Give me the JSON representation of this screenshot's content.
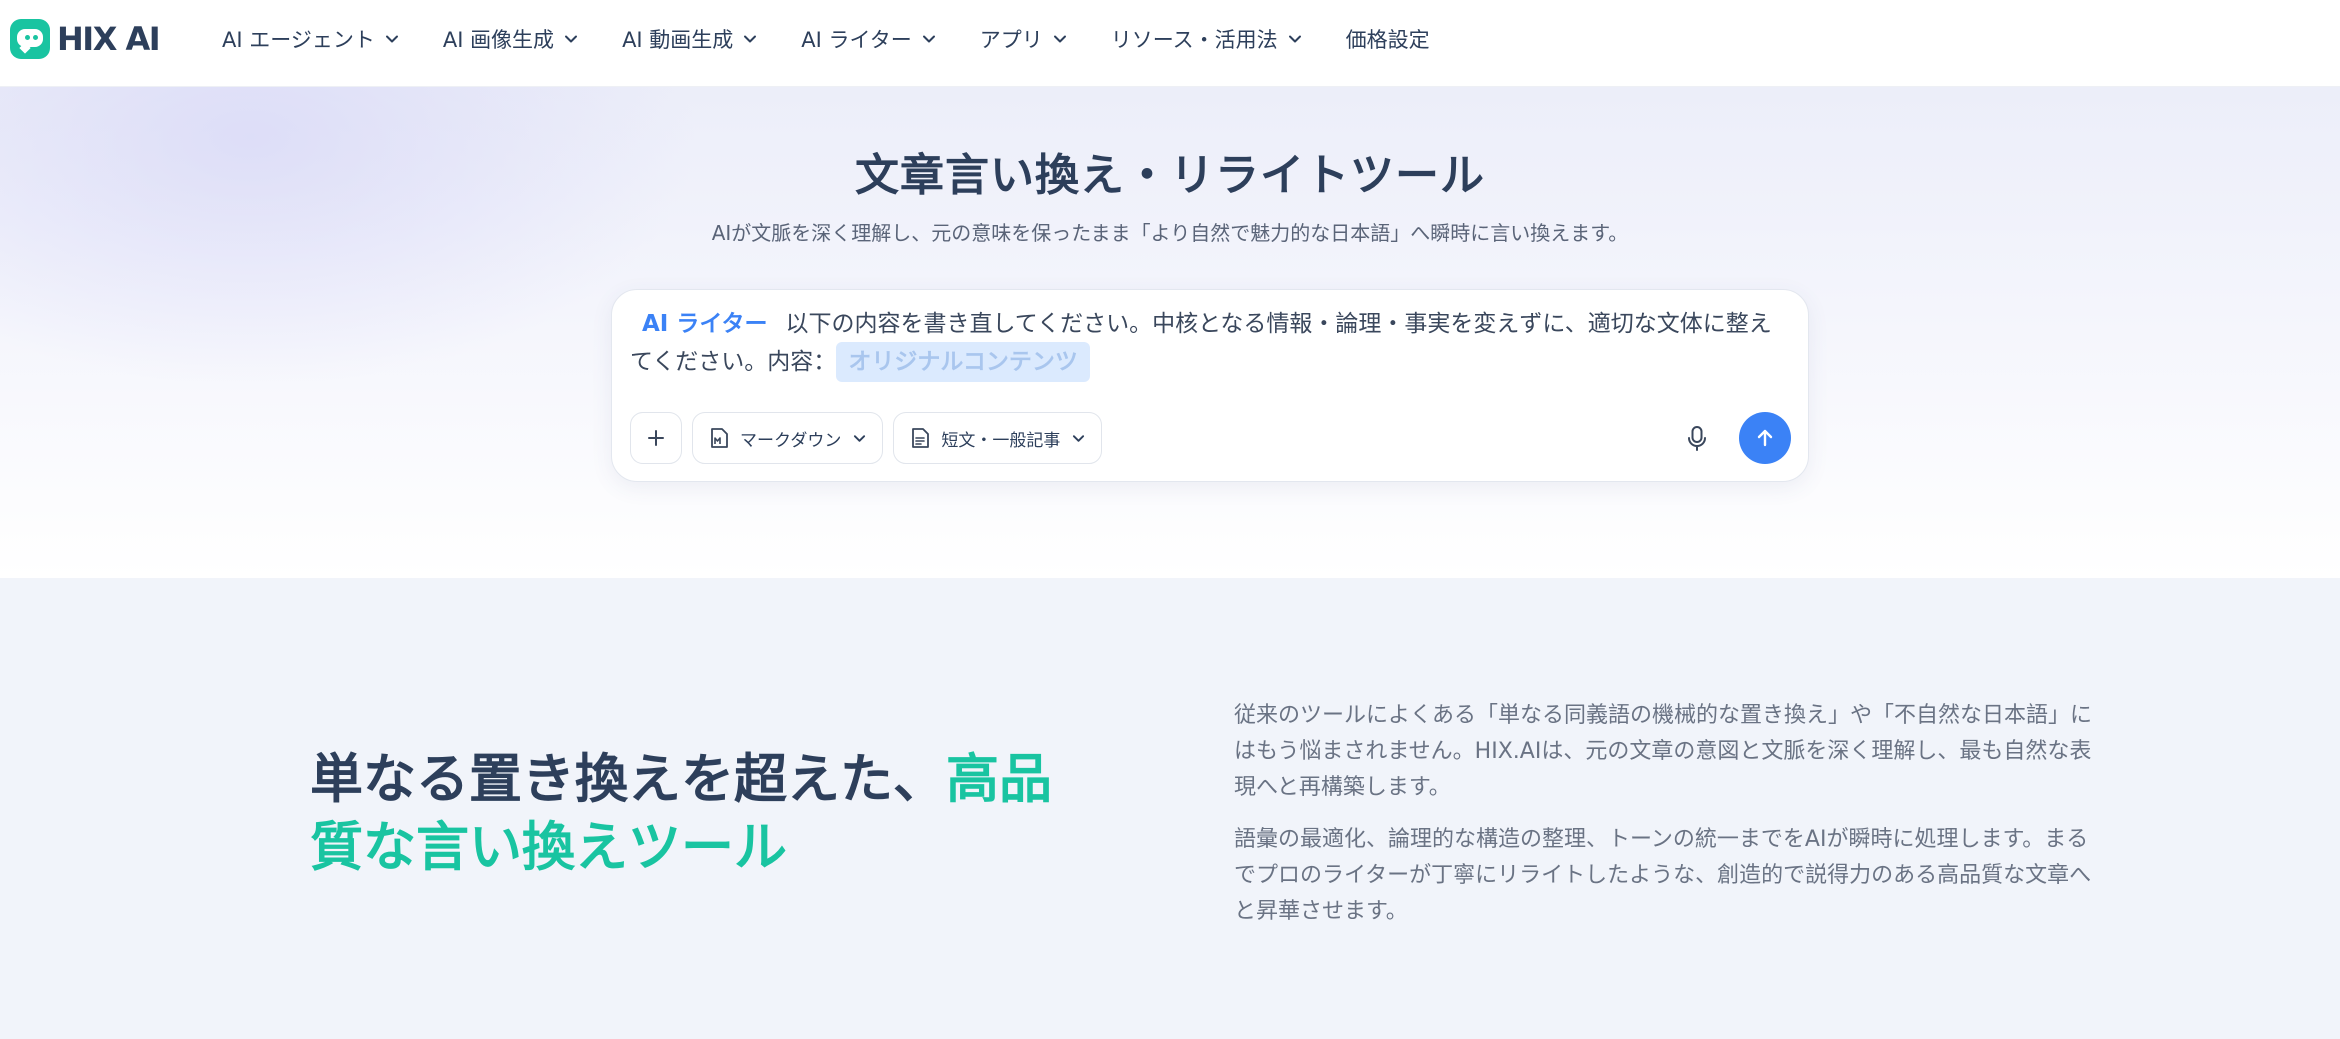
{
  "brand": {
    "name": "HIX AI"
  },
  "nav": {
    "items": [
      {
        "label": "AI エージェント"
      },
      {
        "label": "AI 画像生成"
      },
      {
        "label": "AI 動画生成"
      },
      {
        "label": "AI ライター"
      },
      {
        "label": "アプリ"
      },
      {
        "label": "リソース・活用法"
      },
      {
        "label": "価格設定"
      }
    ]
  },
  "hero": {
    "title": "文章言い換え・リライトツール",
    "subtitle": "AIが文脈を深く理解し、元の意味を保ったまま「より自然で魅力的な日本語」へ瞬時に言い換えます。"
  },
  "prompt": {
    "tag": "AI ライター",
    "text": "以下の内容を書き直してください。中核となる情報・論理・事実を変えずに、適切な文体に整えてください。内容：",
    "placeholder_chip": "オリジナルコンテンツ",
    "format_label": "マークダウン",
    "length_label": "短文・一般記事"
  },
  "colors": {
    "accent_green": "#19c4a1",
    "accent_blue": "#3b82f6",
    "text_dark": "#2d3f5b"
  },
  "feature": {
    "title_main": "単なる置き換えを超えた、",
    "title_accent": "高品質な言い換えツール",
    "paragraph1": "従来のツールによくある「単なる同義語の機械的な置き換え」や「不自然な日本語」にはもう悩まされません。HIX.AIは、元の文章の意図と文脈を深く理解し、最も自然な表現へと再構築します。",
    "paragraph2": "語彙の最適化、論理的な構造の整理、トーンの統一までをAIが瞬時に処理します。まるでプロのライターが丁寧にリライトしたような、創造的で説得力のある高品質な文章へと昇華させます。"
  }
}
